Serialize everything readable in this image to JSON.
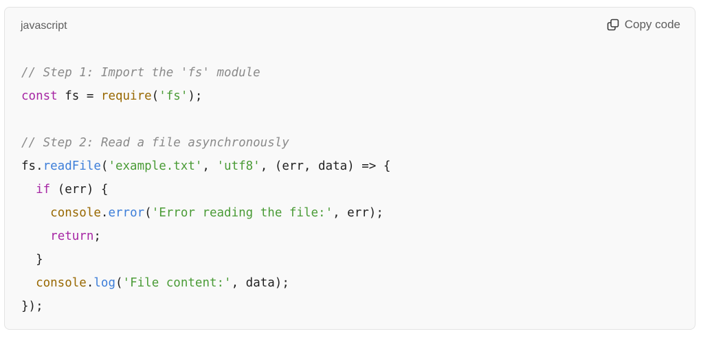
{
  "header": {
    "language": "javascript",
    "copy_label": "Copy code",
    "copy_icon": "copy-icon"
  },
  "code_lines": [
    [
      {
        "t": "// Step 1: Import the 'fs' module",
        "c": "comment"
      }
    ],
    [
      {
        "t": "const",
        "c": "keyword"
      },
      {
        "t": " fs = ",
        "c": "plain"
      },
      {
        "t": "require",
        "c": "builtin"
      },
      {
        "t": "(",
        "c": "plain"
      },
      {
        "t": "'fs'",
        "c": "string"
      },
      {
        "t": ");",
        "c": "plain"
      }
    ],
    [],
    [
      {
        "t": "// Step 2: Read a file asynchronously",
        "c": "comment"
      }
    ],
    [
      {
        "t": "fs.",
        "c": "plain"
      },
      {
        "t": "readFile",
        "c": "method"
      },
      {
        "t": "(",
        "c": "plain"
      },
      {
        "t": "'example.txt'",
        "c": "string"
      },
      {
        "t": ", ",
        "c": "plain"
      },
      {
        "t": "'utf8'",
        "c": "string"
      },
      {
        "t": ", (err, data) => {",
        "c": "plain"
      }
    ],
    [
      {
        "t": "  ",
        "c": "plain"
      },
      {
        "t": "if",
        "c": "keyword"
      },
      {
        "t": " (err) {",
        "c": "plain"
      }
    ],
    [
      {
        "t": "    ",
        "c": "plain"
      },
      {
        "t": "console",
        "c": "builtin"
      },
      {
        "t": ".",
        "c": "plain"
      },
      {
        "t": "error",
        "c": "method"
      },
      {
        "t": "(",
        "c": "plain"
      },
      {
        "t": "'Error reading the file:'",
        "c": "string"
      },
      {
        "t": ", err);",
        "c": "plain"
      }
    ],
    [
      {
        "t": "    ",
        "c": "plain"
      },
      {
        "t": "return",
        "c": "keyword"
      },
      {
        "t": ";",
        "c": "plain"
      }
    ],
    [
      {
        "t": "  }",
        "c": "plain"
      }
    ],
    [
      {
        "t": "  ",
        "c": "plain"
      },
      {
        "t": "console",
        "c": "builtin"
      },
      {
        "t": ".",
        "c": "plain"
      },
      {
        "t": "log",
        "c": "method"
      },
      {
        "t": "(",
        "c": "plain"
      },
      {
        "t": "'File content:'",
        "c": "string"
      },
      {
        "t": ", data);",
        "c": "plain"
      }
    ],
    [
      {
        "t": "});",
        "c": "plain"
      }
    ]
  ],
  "colors": {
    "comment": "#8a8a8a",
    "keyword": "#a626a4",
    "builtin": "#986801",
    "string": "#4a9b36",
    "method": "#3d7ed9",
    "plain": "#1f1f1f",
    "background": "#f9f9f9"
  }
}
